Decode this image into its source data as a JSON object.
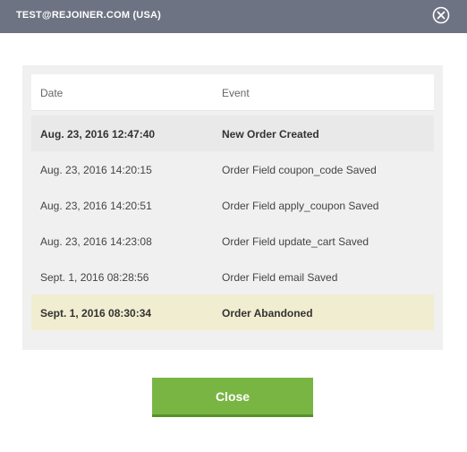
{
  "header": {
    "title": "TEST@REJOINER.COM (USA)",
    "close_icon": "close-circle-icon"
  },
  "table": {
    "columns": [
      "Date",
      "Event"
    ],
    "rows": [
      {
        "date": "Aug. 23, 2016 12:47:40",
        "event": "New Order Created"
      },
      {
        "date": "Aug. 23, 2016 14:20:15",
        "event": "Order Field coupon_code Saved"
      },
      {
        "date": "Aug. 23, 2016 14:20:51",
        "event": "Order Field apply_coupon Saved"
      },
      {
        "date": "Aug. 23, 2016 14:23:08",
        "event": "Order Field update_cart Saved"
      },
      {
        "date": "Sept. 1, 2016 08:28:56",
        "event": "Order Field email Saved"
      },
      {
        "date": "Sept. 1, 2016 08:30:34",
        "event": "Order Abandoned"
      }
    ]
  },
  "footer": {
    "close_label": "Close"
  },
  "colors": {
    "header_bg": "#6e7383",
    "highlight_row": "#f1edd0",
    "button": "#79b543"
  }
}
